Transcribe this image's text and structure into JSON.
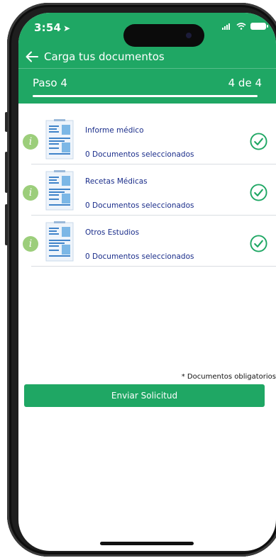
{
  "status_bar": {
    "time": "3:54"
  },
  "header": {
    "title": "Carga tus documentos",
    "step_label": "Paso 4",
    "step_count": "4 de 4",
    "progress": 1.0,
    "accent_color": "#1fa764"
  },
  "documents": [
    {
      "title": "Informe médico",
      "status": "0 Documentos seleccionados"
    },
    {
      "title": "Recetas Médicas",
      "status": "0 Documentos seleccionados"
    },
    {
      "title": "Otros Estudios",
      "status": "0 Documentos seleccionados"
    }
  ],
  "footer": {
    "required_note": "* Documentos obligatorios",
    "submit_label": "Enviar Solicitud"
  }
}
